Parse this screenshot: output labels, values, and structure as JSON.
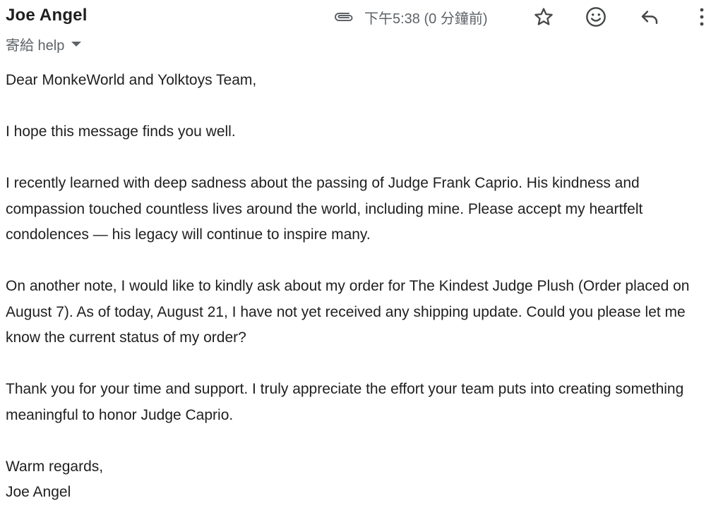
{
  "header": {
    "sender_name": "Joe Angel",
    "timestamp": "下午5:38 (0 分鐘前)",
    "icons": {
      "attachment": "paperclip-icon",
      "star": "star-icon",
      "emoji": "emoji-smile-icon",
      "reply": "reply-icon",
      "more": "more-vert-icon"
    }
  },
  "recipient": {
    "label": "寄給 help"
  },
  "message": {
    "greeting": "Dear MonkeWorld and Yolktoys Team,",
    "p1": "I hope this message finds you well.",
    "p2": "I recently learned with deep sadness about the passing of Judge Frank Caprio. His kindness and compassion touched countless lives around the world, including mine. Please accept my heartfelt condolences — his legacy will continue to inspire many.",
    "p3": "On another note, I would like to kindly ask about my order for The Kindest Judge Plush (Order placed on August 7). As of today, August 21, I have not yet received any shipping update. Could you please let me know the current status of my order?",
    "p4": "Thank you for your time and support. I truly appreciate the effort your team puts into creating something meaningful to honor Judge Caprio.",
    "closing": "Warm regards,",
    "signature": "Joe Angel"
  },
  "colors": {
    "text": "#1f1f1f",
    "meta": "#5f6368",
    "icon": "#444746"
  }
}
